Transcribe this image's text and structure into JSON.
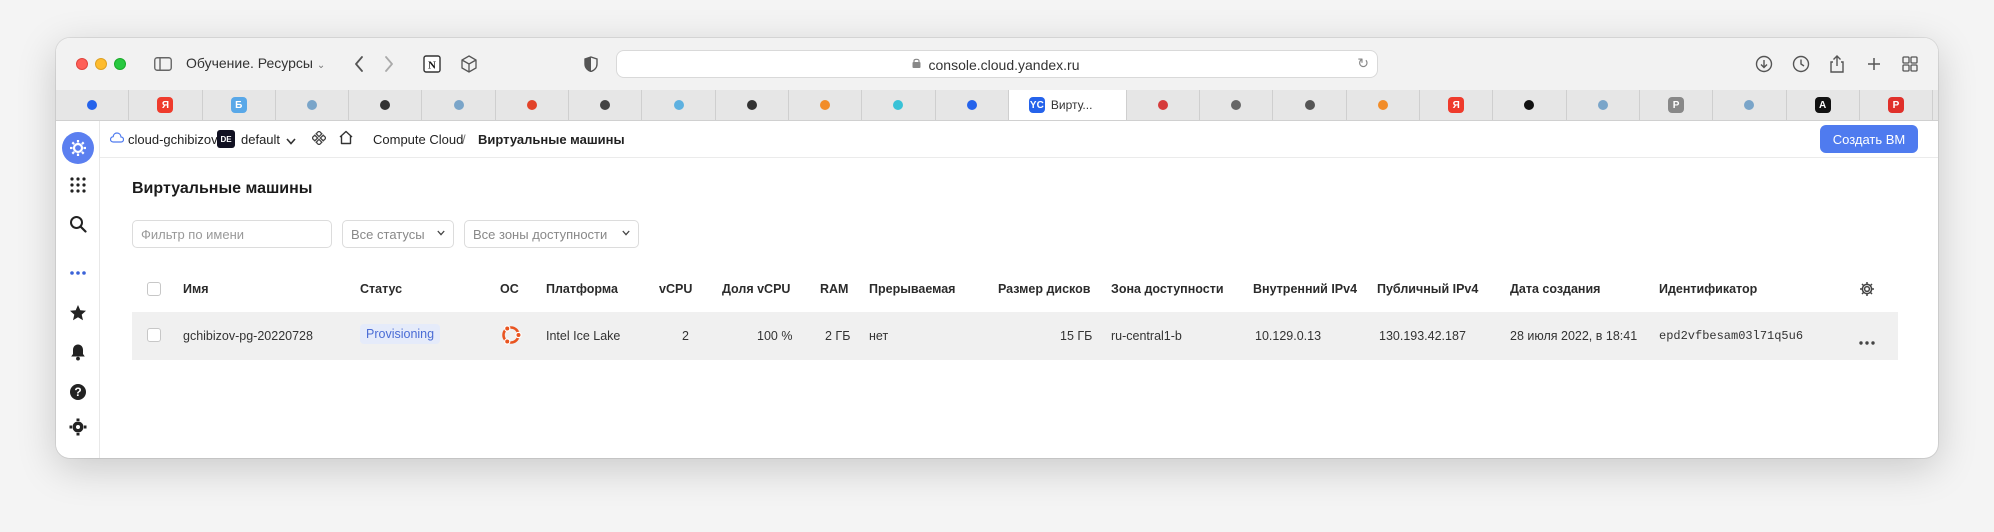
{
  "browser": {
    "tab_group_title": "Обучение. Ресурсы",
    "url": "console.cloud.yandex.ru",
    "tabs": [
      {
        "icon": "confluence-icon",
        "color": "#2563eb"
      },
      {
        "icon": "yandex-icon",
        "color": "#ef3b2c",
        "glyph": "Я"
      },
      {
        "icon": "b-icon",
        "color": "#59a8e8",
        "glyph": "Б"
      },
      {
        "icon": "dot-icon",
        "color": "#7aa5c9"
      },
      {
        "icon": "feather-icon",
        "color": "#333"
      },
      {
        "icon": "dot-icon",
        "color": "#7aa5c9"
      },
      {
        "icon": "gitlab-icon",
        "color": "#e24329"
      },
      {
        "icon": "shield-icon",
        "color": "#444"
      },
      {
        "icon": "app-icon",
        "color": "#5eb1e0"
      },
      {
        "icon": "grid-icon",
        "color": "#333"
      },
      {
        "icon": "arrow-icon",
        "color": "#f28c28"
      },
      {
        "icon": "robot-icon",
        "color": "#39c2d7"
      },
      {
        "icon": "confluence-icon",
        "color": "#2563eb"
      },
      {
        "icon": "yc-icon",
        "color": "#2563eb",
        "glyph": "YC",
        "active": true,
        "label": "Вирту..."
      },
      {
        "icon": "code-icon",
        "color": "#d63b3b"
      },
      {
        "icon": "chip-icon",
        "color": "#666"
      },
      {
        "icon": "cloud-icon",
        "color": "#555"
      },
      {
        "icon": "shield-icon",
        "color": "#f28c28"
      },
      {
        "icon": "yandex-icon",
        "color": "#ef3b2c",
        "glyph": "Я"
      },
      {
        "icon": "qr-icon",
        "color": "#111"
      },
      {
        "icon": "dot-icon",
        "color": "#7aa5c9"
      },
      {
        "icon": "p-icon",
        "color": "#888",
        "glyph": "P"
      },
      {
        "icon": "dot-icon",
        "color": "#7aa5c9"
      },
      {
        "icon": "a-icon",
        "color": "#111",
        "glyph": "A"
      },
      {
        "icon": "p-red-icon",
        "color": "#e0302a",
        "glyph": "P"
      }
    ]
  },
  "header": {
    "cloud": "cloud-gchibizov",
    "folder_badge": "DE",
    "folder": "default",
    "service": "Compute Cloud",
    "separator": "/",
    "current": "Виртуальные машины",
    "create_button": "Создать ВМ"
  },
  "page": {
    "title": "Виртуальные машины",
    "filter_placeholder": "Фильтр по имени",
    "status_select": "Все статусы",
    "zone_select": "Все зоны доступности"
  },
  "table": {
    "columns": [
      "Имя",
      "Статус",
      "ОС",
      "Платформа",
      "vCPU",
      "Доля vCPU",
      "RAM",
      "Прерываемая",
      "Размер дисков",
      "Зона доступности",
      "Внутренний IPv4",
      "Публичный IPv4",
      "Дата создания",
      "Идентификатор"
    ],
    "rows": [
      {
        "name": "gchibizov-pg-20220728",
        "status": "Provisioning",
        "os": "ubuntu",
        "platform": "Intel Ice Lake",
        "vcpu": "2",
        "vcpu_share": "100 %",
        "ram": "2 ГБ",
        "preemptible": "нет",
        "disk_size": "15 ГБ",
        "zone": "ru-central1-b",
        "internal_ip": "10.129.0.13",
        "public_ip": "130.193.42.187",
        "created": "28 июля 2022, в 18:41",
        "id": "epd2vfbesam03l71q5u6"
      }
    ]
  },
  "colors": {
    "accent": "#4f7bef",
    "status_badge_bg": "#e5ebfa",
    "status_badge_text": "#4a6cd5",
    "ubuntu": "#e95420"
  }
}
